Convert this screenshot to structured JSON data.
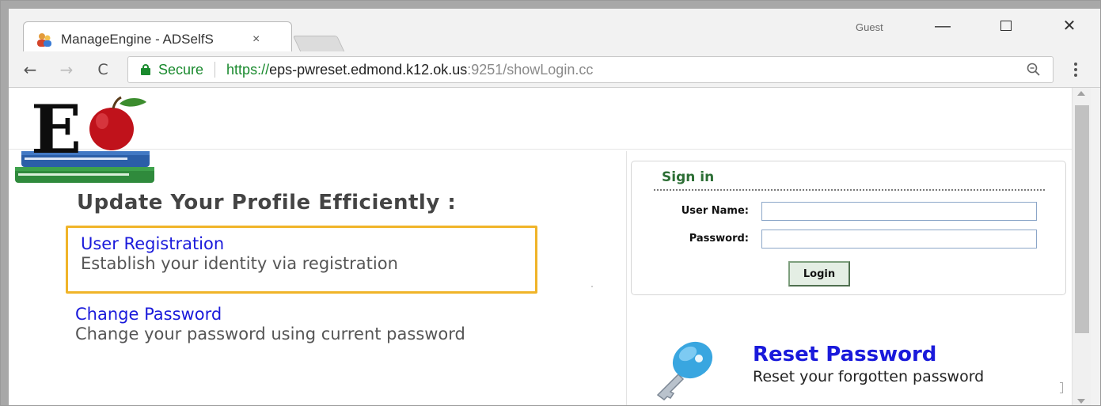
{
  "browser": {
    "tab_title": "ManageEngine - ADSelfS",
    "tab_close": "×",
    "profile": "Guest",
    "address": {
      "secure_label": "Secure",
      "url_scheme": "https://",
      "url_host": "eps-pwreset.edmond.k12.ok.us",
      "url_path": ":9251/showLogin.cc"
    },
    "nav": {
      "back": "←",
      "forward": "→",
      "reload": "C"
    },
    "window_controls": {
      "minimize": "—",
      "close": "✕"
    }
  },
  "page": {
    "headline": "Update Your Profile Efficiently :",
    "user_registration": {
      "title": "User Registration",
      "description": "Establish your identity via registration"
    },
    "change_password": {
      "title": "Change Password",
      "description": "Change your password using current password"
    },
    "signin": {
      "title": "Sign in",
      "username_label": "User Name:",
      "username_value": "",
      "password_label": "Password:",
      "password_value": "",
      "login_button": "Login"
    },
    "reset_password": {
      "title": "Reset Password",
      "description": "Reset your forgotten password"
    }
  },
  "icons": {
    "favicon": "users-icon",
    "logo": "edmond-schools-logo",
    "key": "key-icon",
    "zoom": "zoom-icon",
    "lock": "lock-icon"
  },
  "colors": {
    "link_blue": "#1a1adb",
    "secure_green": "#1a8a2e",
    "signin_green": "#2c6e35",
    "highlight_border": "#f0b429",
    "apple_red": "#c0121b"
  }
}
